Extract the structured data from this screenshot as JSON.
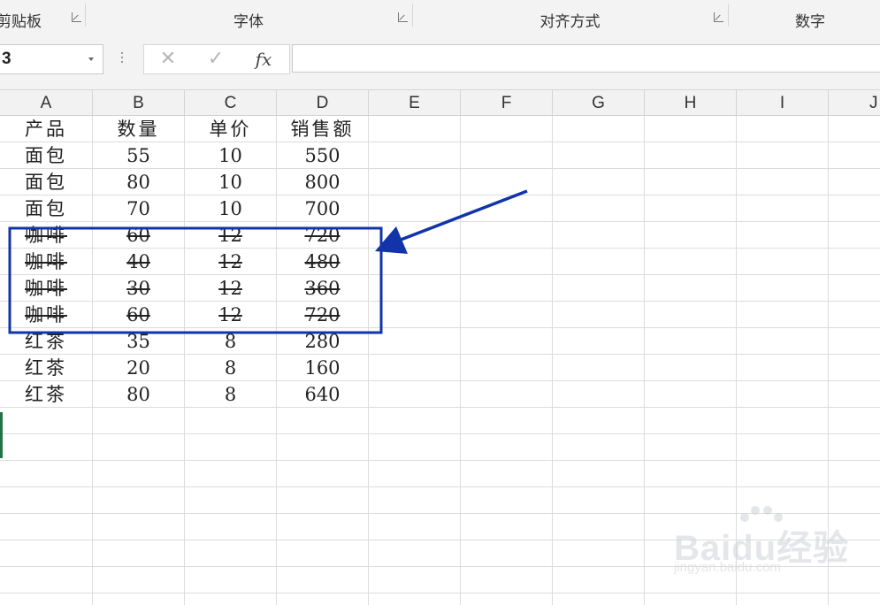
{
  "ribbon": {
    "groups": [
      "剪贴板",
      "字体",
      "对齐方式",
      "数字"
    ]
  },
  "formula_bar": {
    "name_box": "3",
    "cancel_icon": "✕",
    "enter_icon": "✓",
    "fx_label": "fx",
    "formula_value": ""
  },
  "columns": [
    "A",
    "B",
    "C",
    "D",
    "E",
    "F",
    "G",
    "H",
    "I",
    "J"
  ],
  "sheet": {
    "header": [
      "产品",
      "数量",
      "单价",
      "销售额"
    ],
    "rows": [
      {
        "product": "面包",
        "qty": "55",
        "price": "10",
        "sales": "550",
        "strikethrough": false
      },
      {
        "product": "面包",
        "qty": "80",
        "price": "10",
        "sales": "800",
        "strikethrough": false
      },
      {
        "product": "面包",
        "qty": "70",
        "price": "10",
        "sales": "700",
        "strikethrough": false
      },
      {
        "product": "咖啡",
        "qty": "60",
        "price": "12",
        "sales": "720",
        "strikethrough": true
      },
      {
        "product": "咖啡",
        "qty": "40",
        "price": "12",
        "sales": "480",
        "strikethrough": true
      },
      {
        "product": "咖啡",
        "qty": "30",
        "price": "12",
        "sales": "360",
        "strikethrough": true
      },
      {
        "product": "咖啡",
        "qty": "60",
        "price": "12",
        "sales": "720",
        "strikethrough": true
      },
      {
        "product": "红茶",
        "qty": "35",
        "price": "8",
        "sales": "280",
        "strikethrough": false
      },
      {
        "product": "红茶",
        "qty": "20",
        "price": "8",
        "sales": "160",
        "strikethrough": false
      },
      {
        "product": "红茶",
        "qty": "80",
        "price": "8",
        "sales": "640",
        "strikethrough": false
      }
    ]
  },
  "annotation": {
    "color": "#1234a8"
  },
  "watermark": {
    "text": "Baidu经验",
    "subtext": "jingyan.baidu.com"
  }
}
